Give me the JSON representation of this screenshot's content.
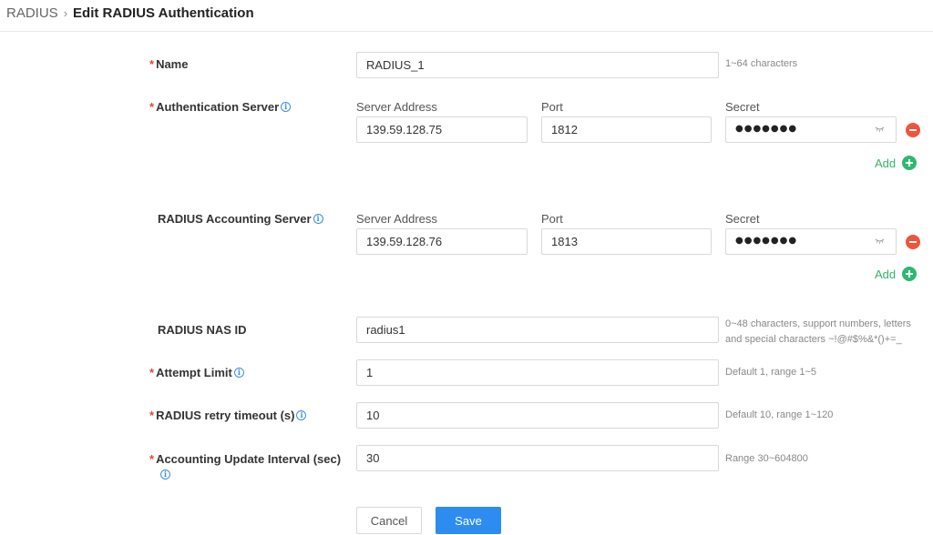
{
  "breadcrumb": {
    "root": "RADIUS",
    "separator": "›",
    "current": "Edit RADIUS Authentication"
  },
  "form": {
    "name": {
      "label": "Name",
      "required": "*",
      "value": "RADIUS_1",
      "hint": "1~64 characters"
    },
    "auth_server": {
      "label": "Authentication Server",
      "required": "*",
      "address_label": "Server Address",
      "port_label": "Port",
      "secret_label": "Secret",
      "address": "139.59.128.75",
      "port": "1812",
      "secret": "●●●●●●●",
      "add_label": "Add"
    },
    "acct_server": {
      "label": "RADIUS Accounting Server",
      "address_label": "Server Address",
      "port_label": "Port",
      "secret_label": "Secret",
      "address": "139.59.128.76",
      "port": "1813",
      "secret": "●●●●●●●",
      "add_label": "Add"
    },
    "nas_id": {
      "label": "RADIUS NAS ID",
      "value": "radius1",
      "hint_line1": "0~48 characters, support numbers, letters",
      "hint_line2": "and special characters ~!@#$%&*()+=_"
    },
    "attempt_limit": {
      "label": "Attempt Limit",
      "required": "*",
      "value": "1",
      "hint": "Default 1, range 1~5"
    },
    "retry_timeout": {
      "label": "RADIUS retry timeout (s)",
      "required": "*",
      "value": "10",
      "hint": "Default 10, range 1~120"
    },
    "acct_interval": {
      "label": "Accounting Update Interval (sec)",
      "required": "*",
      "value": "30",
      "hint": "Range 30~604800"
    }
  },
  "buttons": {
    "cancel": "Cancel",
    "save": "Save"
  },
  "colors": {
    "primary": "#2d8cf0",
    "danger": "#f0543a",
    "success": "#2eb872",
    "required": "#f04134",
    "info": "#3a8ee6"
  }
}
